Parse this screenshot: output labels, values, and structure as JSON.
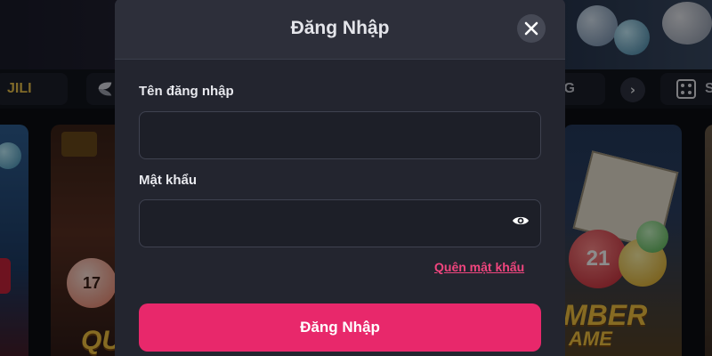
{
  "background": {
    "categories": [
      {
        "label": "JILI",
        "icon": "",
        "accent": "#e9c24b"
      },
      {
        "label": "",
        "icon": "leaf-logo-icon"
      },
      {
        "label": "NG",
        "icon": ""
      },
      {
        "label": "S",
        "icon": "dice-icon"
      }
    ],
    "scroll_icon": "chevron-right-icon",
    "tiles": [
      {
        "title": ""
      },
      {
        "title": "QU",
        "ball_number": "17"
      },
      {
        "title": "MBER",
        "subtitle": "AME",
        "ball_number": "21"
      },
      {
        "title": ""
      }
    ]
  },
  "login_modal": {
    "title": "Đăng Nhập",
    "close_icon": "close-icon",
    "username": {
      "label": "Tên đăng nhập",
      "value": "",
      "placeholder": ""
    },
    "password": {
      "label": "Mật khẩu",
      "value": "",
      "placeholder": "",
      "toggle_icon": "eye-icon"
    },
    "forgot_password": "Quên mật khẩu",
    "submit_label": "Đăng Nhập"
  },
  "colors": {
    "accent": "#e8286b",
    "link": "#f0457e",
    "modal_bg": "#23252f"
  }
}
